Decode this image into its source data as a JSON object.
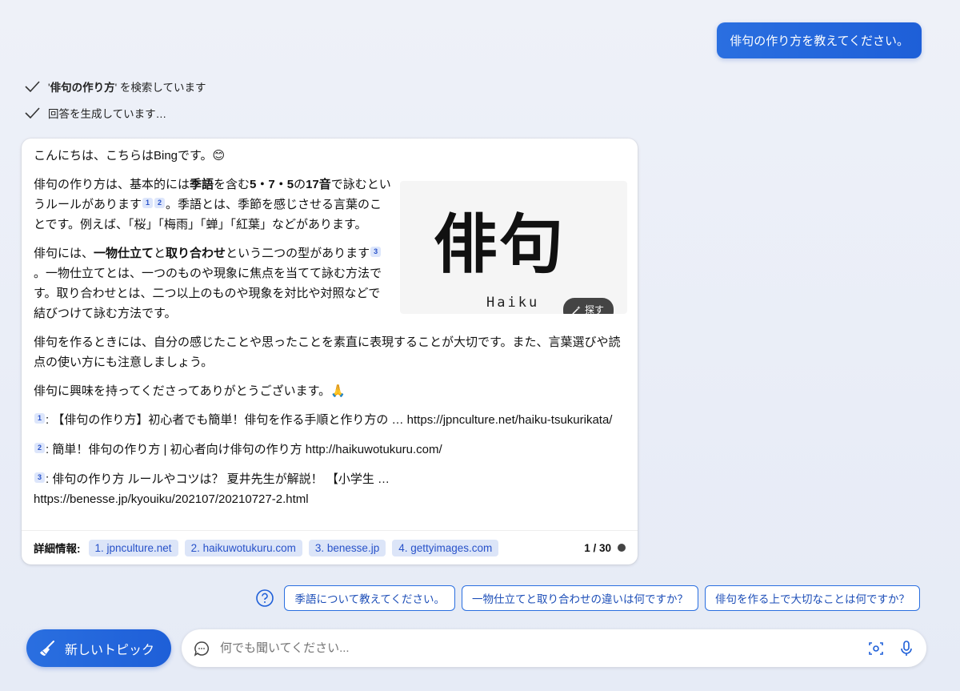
{
  "user_message": "俳句の作り方を教えてください。",
  "status": {
    "search_prefix": "'",
    "search_query": "俳句の作り方",
    "search_suffix": "' を検索しています",
    "generating": "回答を生成しています…"
  },
  "answer": {
    "greeting": "こんにちは、こちらはBingです。😊",
    "p1_a": "俳句の作り方は、基本的には",
    "p1_b1": "季語",
    "p1_c": "を含む",
    "p1_b2": "5・7・5",
    "p1_d": "の",
    "p1_b3": "17音",
    "p1_e": "で詠むというルールがあります",
    "p1_f": "。季語とは、季節を感じさせる言葉のことです。例えば、「桜」「梅雨」「蝉」「紅葉」などがあります。",
    "p2_a": "俳句には、",
    "p2_b1": "一物仕立て",
    "p2_c": "と",
    "p2_b2": "取り合わせ",
    "p2_d": "という二つの型があります",
    "p2_e": "。一物仕立てとは、一つのものや現象に焦点を当てて詠む方法です。取り合わせとは、二つ以上のものや現象を対比や対照などで結びつけて詠む方法です。",
    "p3": "俳句を作るときには、自分の感じたことや思ったことを素直に表現することが大切です。また、言葉選びや読点の使い方にも注意しましょう。",
    "p4": "俳句に興味を持ってくださってありがとうございます。🙏",
    "cite1": "1",
    "cite2": "2",
    "cite3": "3",
    "image": {
      "kanji": "俳句",
      "roman": "Haiku",
      "search_label": "探す"
    }
  },
  "references": [
    {
      "num": "1",
      "text": ": 【俳句の作り方】初心者でも簡単！俳句を作る手順と作り方の … https://jpnculture.net/haiku-tsukurikata/"
    },
    {
      "num": "2",
      "text": ": 簡単！俳句の作り方 | 初心者向け俳句の作り方 http://haikuwotukuru.com/"
    },
    {
      "num": "3",
      "text": ": 俳句の作り方 ルールやコツは？ 夏井先生が解説！ 【小学生 … https://benesse.jp/kyouiku/202107/20210727-2.html"
    }
  ],
  "footer": {
    "label": "詳細情報:",
    "sources": [
      "1. jpnculture.net",
      "2. haikuwotukuru.com",
      "3. benesse.jp",
      "4. gettyimages.com"
    ],
    "counter": "1 / 30"
  },
  "suggestions": [
    "季語について教えてください。",
    "一物仕立てと取り合わせの違いは何ですか？",
    "俳句を作る上で大切なことは何ですか？"
  ],
  "new_topic_label": "新しいトピック",
  "input_placeholder": "何でも聞いてください...",
  "colors": {
    "accent": "#1e5fd8",
    "chip_bg": "#dce5f8",
    "chip_text": "#2852c9"
  }
}
